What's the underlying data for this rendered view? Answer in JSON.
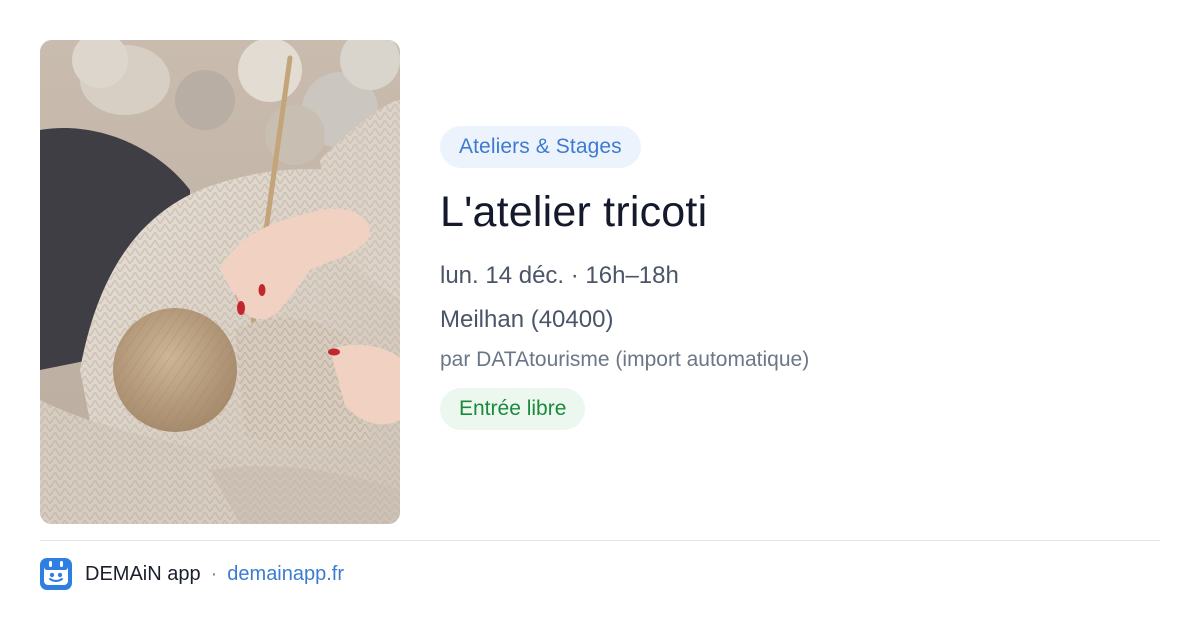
{
  "event": {
    "image_alt": "Knitting photo",
    "category": "Ateliers & Stages",
    "title": "L'atelier tricoti",
    "date": "lun. 14 déc. · 16h–18h",
    "location": "Meilhan (40400)",
    "organizer": "par DATAtourisme (import automatique)",
    "price": "Entrée libre"
  },
  "footer": {
    "app_name": "DEMAiN app",
    "separator": "·",
    "link": "demainapp.fr",
    "app_icon": "demain-app-icon"
  },
  "colors": {
    "accent": "#3d7bd1",
    "category_bg": "#edf3fc",
    "price_text": "#1b8a3d",
    "price_bg": "#ecf8ef",
    "title": "#14192b"
  }
}
